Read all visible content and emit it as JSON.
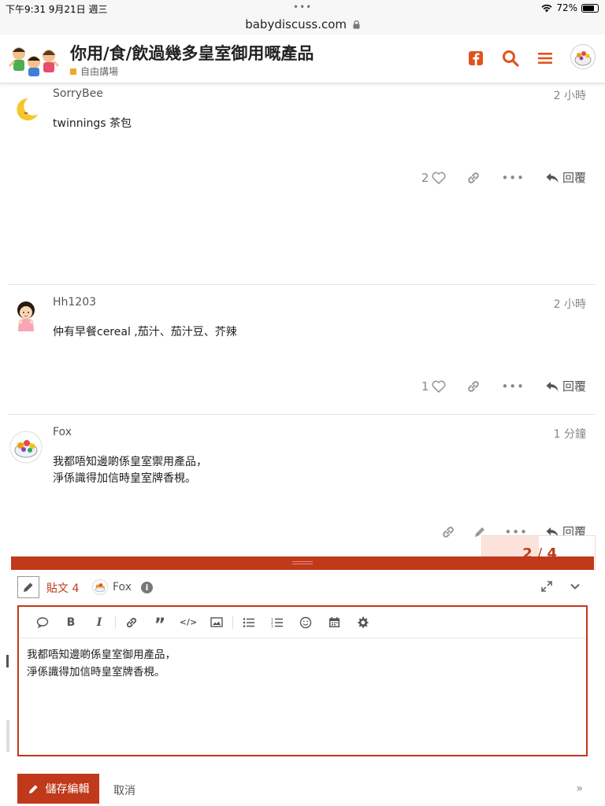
{
  "status_bar": {
    "time": "下午9:31 9月21日 週三",
    "battery": "72%"
  },
  "browser": {
    "url": "babydiscuss.com"
  },
  "header": {
    "title": "你用/食/飲過幾多皇室御用嘅產品",
    "category": "自由講場"
  },
  "posts": [
    {
      "username": "SorryBee",
      "time": "2 小時",
      "body": "twinnings 茶包",
      "likes": "2",
      "reply_label": "回覆"
    },
    {
      "username": "Hh1203",
      "time": "2 小時",
      "body": "仲有早餐cereal ,茄汁、茄汁豆、芥辣",
      "likes": "1",
      "reply_label": "回覆"
    },
    {
      "username": "Fox",
      "time": "1 分鐘",
      "body": "我都唔知邊啲係皇室禦用產品，\n淨係識得加信時皇室牌香梘。",
      "reply_label": "回覆"
    }
  ],
  "progress": {
    "current": "2",
    "separator": "/",
    "total": "4",
    "fraction": 0.5
  },
  "composer": {
    "post_ref": "貼文 4",
    "author": "Fox",
    "text": "我都唔知邊啲係皇室御用產品，\n淨係識得加信時皇室牌香梘。",
    "save_label": "儲存編輯",
    "cancel_label": "取消"
  },
  "colors": {
    "accent": "#c0391b",
    "category": "#f0a830"
  }
}
